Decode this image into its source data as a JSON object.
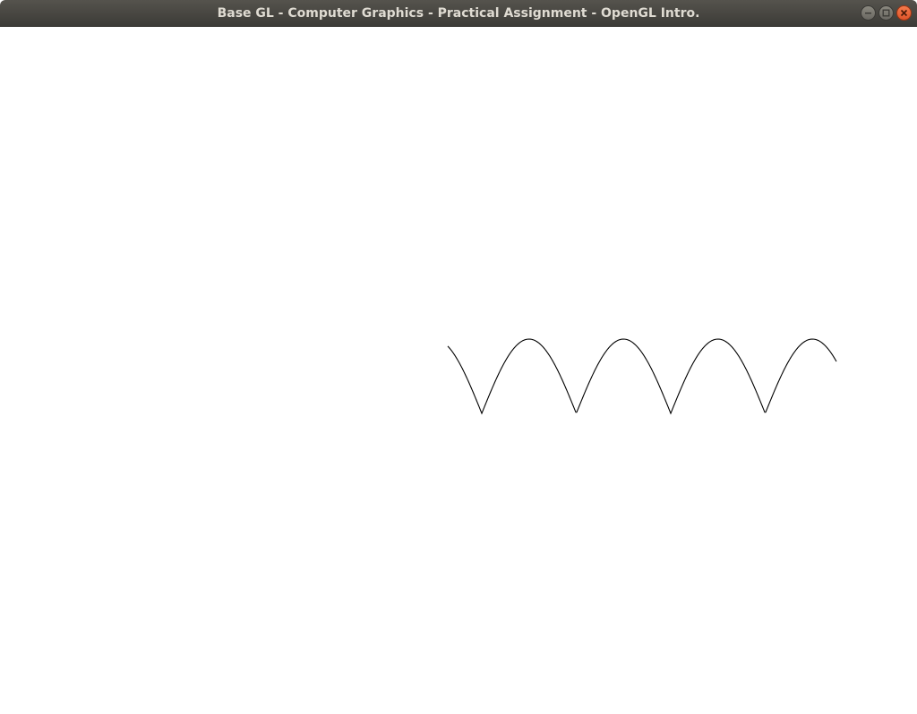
{
  "window": {
    "title": "Base GL - Computer Graphics - Practical Assignment - OpenGL Intro.",
    "controls": {
      "minimize_icon": "minimize-icon",
      "maximize_icon": "maximize-icon",
      "close_icon": "close-icon"
    }
  },
  "canvas": {
    "background": "#ffffff",
    "curve_color": "#000000",
    "curve_description": "abs(sin) style wave curve"
  }
}
